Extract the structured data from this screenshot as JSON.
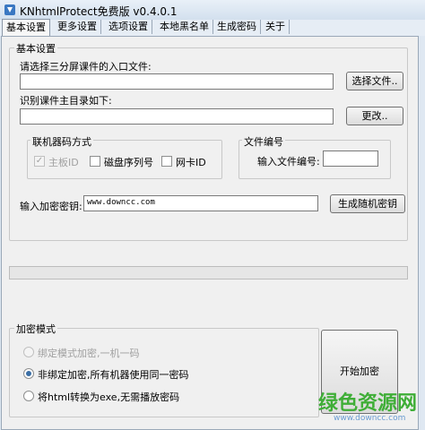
{
  "window": {
    "title": "KNhtmlProtect免费版 v0.4.0.1"
  },
  "tabs": [
    {
      "label": "基本设置"
    },
    {
      "label": "更多设置"
    },
    {
      "label": "选项设置"
    },
    {
      "label": "本地黑名单"
    },
    {
      "label": "生成密码"
    },
    {
      "label": "关于"
    }
  ],
  "basic_group": {
    "title": "基本设置",
    "entry_file_label": "请选择三分屏课件的入口文件:",
    "entry_file_value": "",
    "choose_file_button": "选择文件..",
    "main_dir_label": "识别课件主目录如下:",
    "main_dir_value": "",
    "change_button": "更改.."
  },
  "machine_code": {
    "title": "联机器码方式",
    "options": [
      {
        "label": "主板ID",
        "checked": true,
        "disabled": true
      },
      {
        "label": "磁盘序列号",
        "checked": false,
        "disabled": false
      },
      {
        "label": "网卡ID",
        "checked": false,
        "disabled": false
      }
    ]
  },
  "file_number": {
    "title": "文件编号",
    "input_label": "输入文件编号:",
    "input_value": ""
  },
  "encryption_key": {
    "label": "输入加密密钥:",
    "value": "www.downcc.com",
    "generate_button": "生成随机密钥"
  },
  "encryption_mode": {
    "title": "加密模式",
    "options": [
      {
        "label": "绑定模式加密,一机一码",
        "selected": false,
        "disabled": true
      },
      {
        "label": "非绑定加密,所有机器使用同一密码",
        "selected": true,
        "disabled": false
      },
      {
        "label": "将html转换为exe,无需播放密码",
        "selected": false,
        "disabled": false
      }
    ],
    "start_button": "开始加密"
  },
  "watermark": {
    "brand": "绿色资源网",
    "url": "www.downcc.com"
  },
  "colors": {
    "watermark_green": "#3fae37",
    "watermark_blue": "#6a9bd1",
    "radio_selected": "#3a6ea5"
  }
}
